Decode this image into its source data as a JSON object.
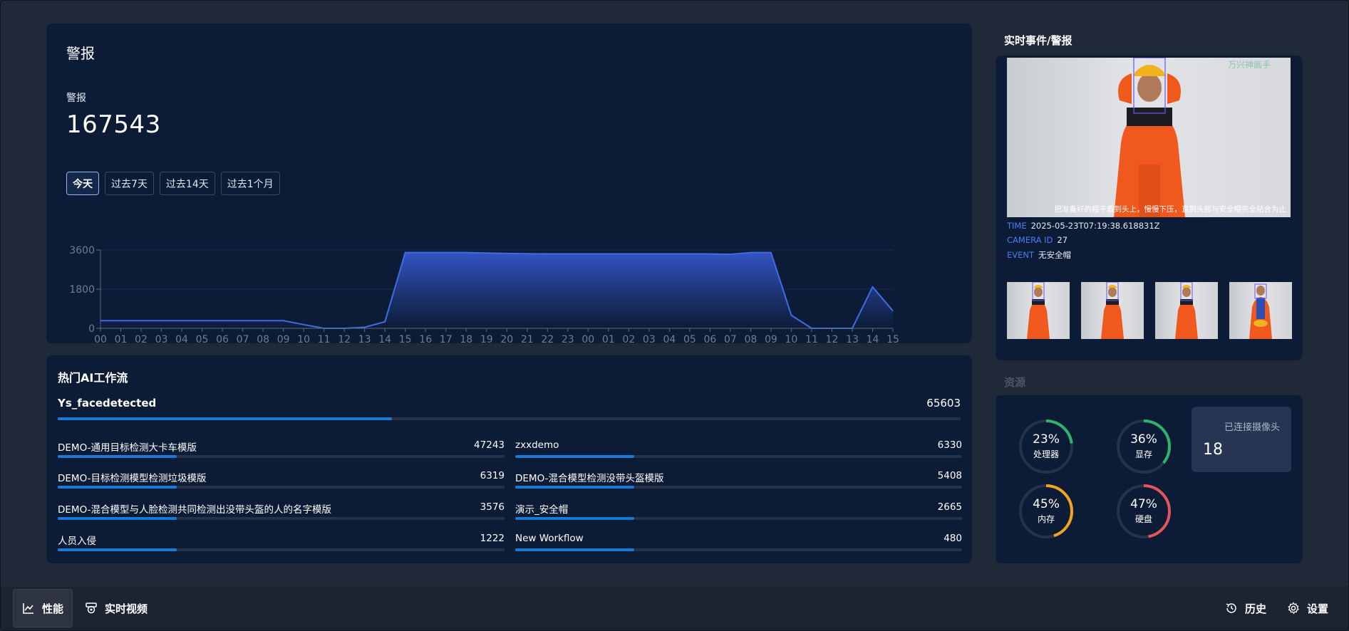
{
  "alarm": {
    "title": "警报",
    "subtitle": "警报",
    "count": "167543",
    "ranges": [
      "今天",
      "过去7天",
      "过去14天",
      "过去1个月"
    ],
    "active_range": "今天"
  },
  "chart_data": {
    "type": "area",
    "x": [
      "00",
      "01",
      "02",
      "03",
      "04",
      "05",
      "06",
      "07",
      "08",
      "09",
      "10",
      "11",
      "12",
      "13",
      "14",
      "15",
      "16",
      "17",
      "18",
      "19",
      "20",
      "21",
      "22",
      "23",
      "00",
      "01",
      "02",
      "03",
      "04",
      "05",
      "06",
      "07",
      "08",
      "09",
      "10",
      "11",
      "12",
      "13",
      "14",
      "15"
    ],
    "series": [
      {
        "values": [
          350,
          350,
          350,
          350,
          350,
          350,
          350,
          350,
          350,
          350,
          170,
          0,
          0,
          50,
          300,
          3480,
          3480,
          3480,
          3480,
          3460,
          3440,
          3430,
          3420,
          3420,
          3420,
          3420,
          3420,
          3420,
          3420,
          3420,
          3420,
          3400,
          3480,
          3480,
          600,
          0,
          0,
          0,
          1900,
          800
        ]
      }
    ],
    "yticks": [
      0,
      1800,
      3600
    ],
    "ylim": [
      0,
      3600
    ],
    "colors": {
      "line": "#3f6be8",
      "fill_top": "#3556c9",
      "fill_bottom": "#0c1c36"
    }
  },
  "workflows": {
    "title": "热门AI工作流",
    "top": {
      "name": "Ys_facedetected",
      "value": "65603",
      "fill": 0.37
    },
    "items": [
      {
        "name": "DEMO-通用目标检测大卡车模版",
        "value": "47243"
      },
      {
        "name": "zxxdemo",
        "value": "6330"
      },
      {
        "name": "DEMO-目标检测模型检测垃圾模版",
        "value": "6319"
      },
      {
        "name": "DEMO-混合模型检测没带头盔模版",
        "value": "5408"
      },
      {
        "name": "DEMO-混合模型与人脸检测共同检测出没带头盔的人的名字模版",
        "value": "3576"
      },
      {
        "name": "演示_安全帽",
        "value": "2665"
      },
      {
        "name": "人员入侵",
        "value": "1222"
      },
      {
        "name": "New Workflow",
        "value": "480"
      }
    ]
  },
  "events": {
    "title": "实时事件/警报",
    "image_caption": "把准备好的帽子戴到头上，慢慢下压，直到头部与安全帽完全贴合为止",
    "image_logo": "万兴神画手",
    "time_key": "TIME",
    "time_val": "2025-05-23T07:19:38.618831Z",
    "camera_key": "CAMERA ID",
    "camera_val": "27",
    "event_key": "EVENT",
    "event_val": "无安全帽"
  },
  "resources": {
    "title": "资源",
    "gauges": [
      {
        "pct": "23%",
        "label": "处理器",
        "value": 0.23,
        "color": "#2fb36a"
      },
      {
        "pct": "36%",
        "label": "显存",
        "value": 0.36,
        "color": "#2fb36a"
      },
      {
        "pct": "45%",
        "label": "内存",
        "value": 0.45,
        "color": "#f0a422"
      },
      {
        "pct": "47%",
        "label": "硬盘",
        "value": 0.47,
        "color": "#e5535b"
      }
    ],
    "camera_label": "已连接摄像头",
    "camera_count": "18"
  },
  "nav": {
    "performance": "性能",
    "live_video": "实时视频",
    "history": "历史",
    "settings": "设置"
  }
}
